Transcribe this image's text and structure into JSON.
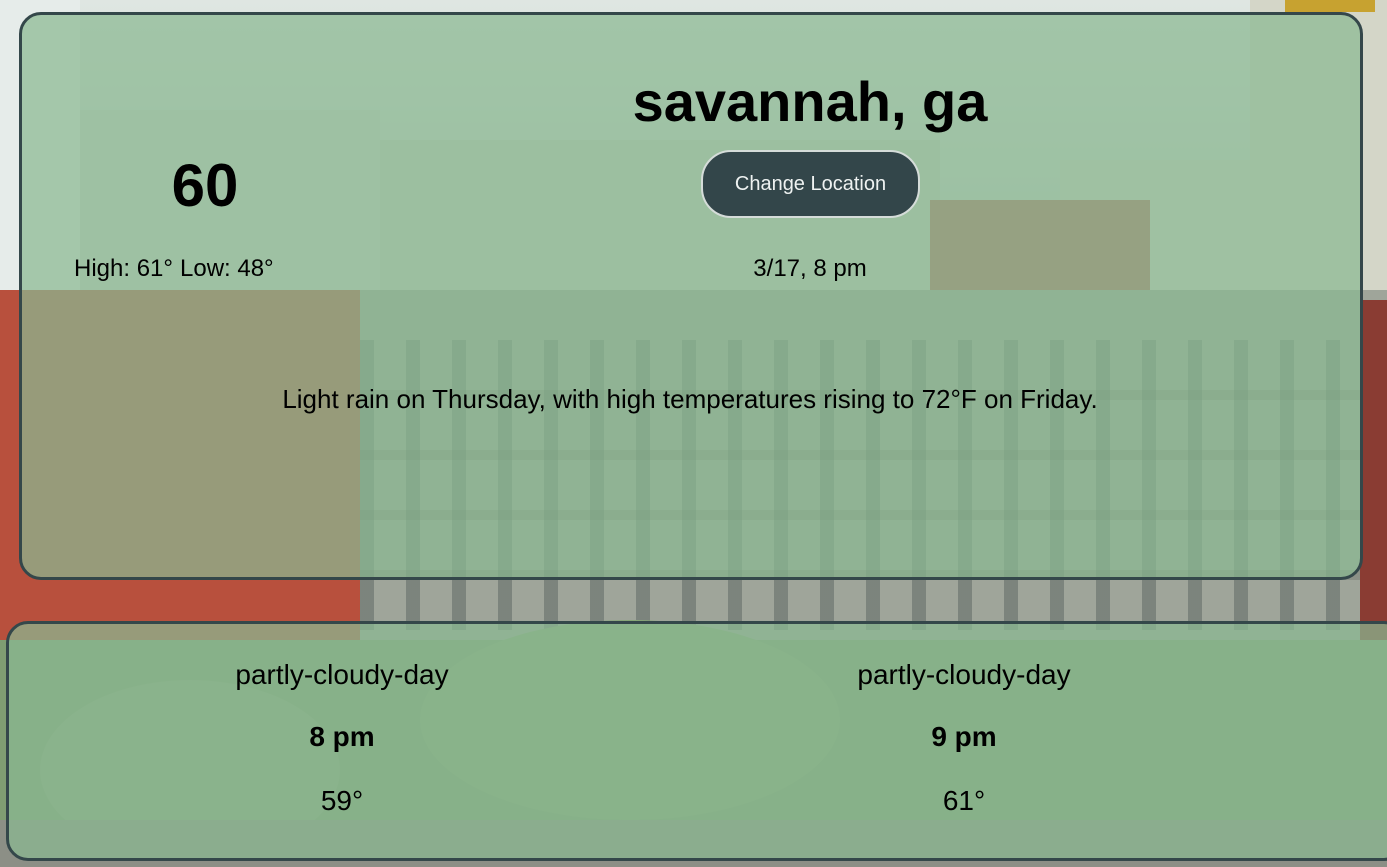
{
  "location": {
    "city": "savannah, ga",
    "change_label": "Change Location"
  },
  "current": {
    "temperature": "60",
    "high_label": "High: 61°",
    "low_label": "Low: 48°",
    "datetime": "3/17, 8 pm",
    "summary": "Light rain on Thursday, with high temperatures rising to 72°F on Friday."
  },
  "hourly": [
    {
      "condition": "partly-cloudy-day",
      "time": "8 pm",
      "temperature": "59°"
    },
    {
      "condition": "partly-cloudy-day",
      "time": "9 pm",
      "temperature": "61°"
    }
  ],
  "colors": {
    "card_overlay": "#8ab892",
    "card_border": "#34474a",
    "button_bg": "#33464a"
  }
}
